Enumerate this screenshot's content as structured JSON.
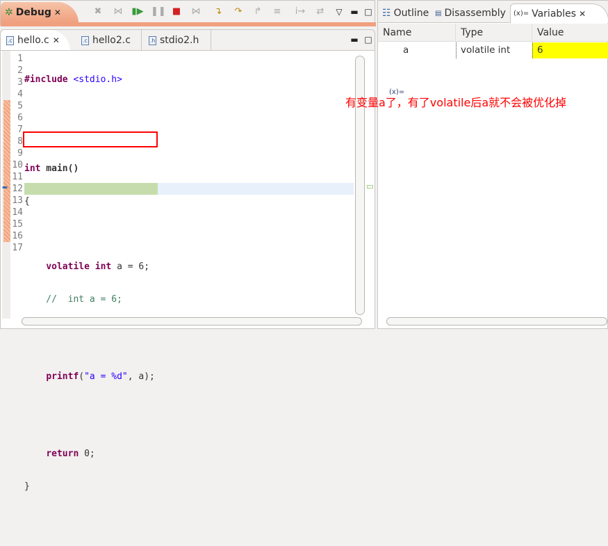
{
  "debug_view": {
    "tab_label": "Debug",
    "toolbar": [
      "remove-all-terminated",
      "connect",
      "resume",
      "suspend",
      "terminate",
      "disconnect",
      "step-into",
      "step-over",
      "step-return",
      "drop-to-frame",
      "instruction-stepping",
      "step-filters"
    ]
  },
  "editor": {
    "tabs": [
      {
        "label": "hello.c",
        "icon": ".c",
        "active": true
      },
      {
        "label": "hello2.c",
        "icon": ".c"
      },
      {
        "label": "stdio2.h",
        "icon": ".h"
      }
    ],
    "line_numbers": [
      "1",
      "2",
      "3",
      "4",
      "5",
      "6",
      "7",
      "8",
      "9",
      "10",
      "11",
      "12",
      "13",
      "14",
      "15",
      "16",
      "17"
    ],
    "code": {
      "l1_kw": "#include",
      "l1_rest": " <stdio.h>",
      "l5_kw": "int",
      "l5_rest": " main()",
      "l6": "{",
      "l8_indent": "    ",
      "l8_kw1": "volatile",
      "l8_kw2": "int",
      "l8_rest": " a = 6;",
      "l9": "    //  int a = 6;",
      "l12_fn": "printf",
      "l12_open": "(",
      "l12_str": "\"a = %d\"",
      "l12_rest": ", a);",
      "l15_kw": "return",
      "l15_rest": " 0;",
      "l16": "}"
    },
    "current_line": "12"
  },
  "variables_view": {
    "tabs": [
      "Outline",
      "Disassembly",
      "Variables"
    ],
    "columns": [
      "Name",
      "Type",
      "Value"
    ],
    "rows": [
      {
        "icon": "(x)=",
        "name": "a",
        "type": "volatile int",
        "value": "6"
      }
    ],
    "changed_value_color": "#ffff00"
  },
  "annotation": "有变量a了，有了volatile后a就不会被优化掉"
}
